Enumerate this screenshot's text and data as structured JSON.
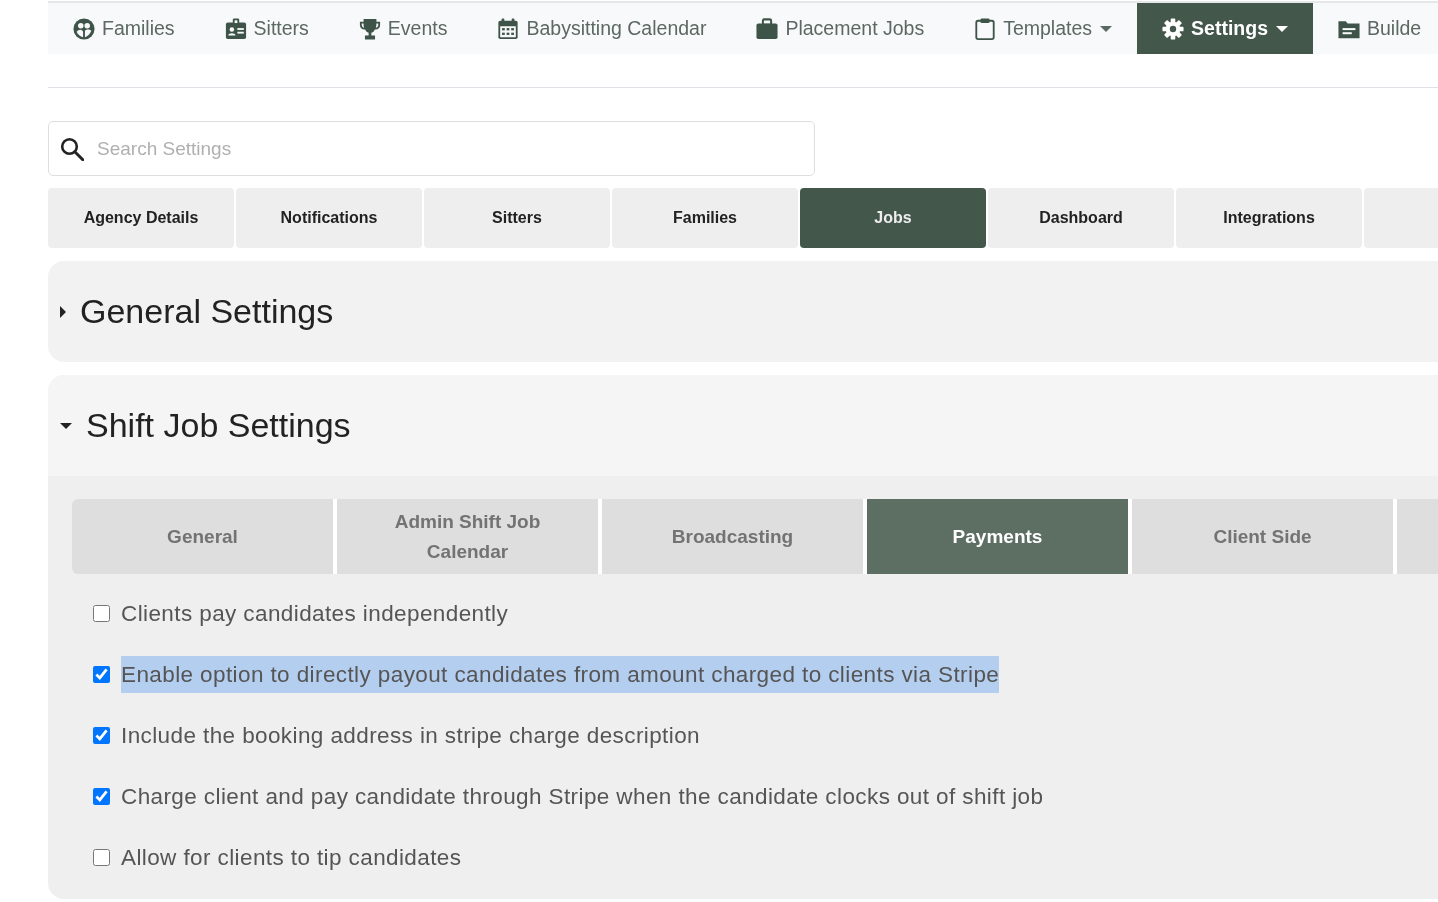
{
  "nav": {
    "items": [
      {
        "kind": "families",
        "label": "Families",
        "selected": false,
        "dropdown": false
      },
      {
        "kind": "sitters",
        "label": "Sitters",
        "selected": false,
        "dropdown": false
      },
      {
        "kind": "events",
        "label": "Events",
        "selected": false,
        "dropdown": false
      },
      {
        "kind": "calendar",
        "label": "Babysitting Calendar",
        "selected": false,
        "dropdown": false
      },
      {
        "kind": "jobs",
        "label": "Placement Jobs",
        "selected": false,
        "dropdown": false
      },
      {
        "kind": "templates",
        "label": "Templates",
        "selected": false,
        "dropdown": true
      },
      {
        "kind": "settings",
        "label": "Settings",
        "selected": true,
        "dropdown": true
      },
      {
        "kind": "builder",
        "label": "Builde",
        "selected": false,
        "dropdown": false
      }
    ]
  },
  "search": {
    "placeholder": "Search Settings"
  },
  "tabs": [
    {
      "label": "Agency Details",
      "selected": false
    },
    {
      "label": "Notifications",
      "selected": false
    },
    {
      "label": "Sitters",
      "selected": false
    },
    {
      "label": "Families",
      "selected": false
    },
    {
      "label": "Jobs",
      "selected": true
    },
    {
      "label": "Dashboard",
      "selected": false
    },
    {
      "label": "Integrations",
      "selected": false
    },
    {
      "selected": false
    }
  ],
  "sections": [
    {
      "title": "General Settings",
      "expanded": false
    },
    {
      "title": "Shift Job Settings",
      "expanded": true,
      "subtabs": [
        {
          "label": "General",
          "selected": false
        },
        {
          "label": "Admin Shift Job Calendar",
          "selected": false
        },
        {
          "label": "Broadcasting",
          "selected": false
        },
        {
          "label": "Payments",
          "selected": true
        },
        {
          "label": "Client Side",
          "selected": false
        },
        {
          "selected": false
        }
      ],
      "options": [
        {
          "label": "Clients pay candidates independently",
          "checked": false,
          "highlighted": false
        },
        {
          "label": "Enable option to directly payout candidates from amount charged to clients via Stripe",
          "checked": true,
          "highlighted": true
        },
        {
          "label": "Include the booking address in stripe charge description",
          "checked": true,
          "highlighted": false
        },
        {
          "label": "Charge client and pay candidate through Stripe when the candidate clocks out of shift job",
          "checked": true,
          "highlighted": false
        },
        {
          "label": "Allow for clients to tip candidates",
          "checked": false,
          "highlighted": false
        }
      ]
    }
  ]
}
